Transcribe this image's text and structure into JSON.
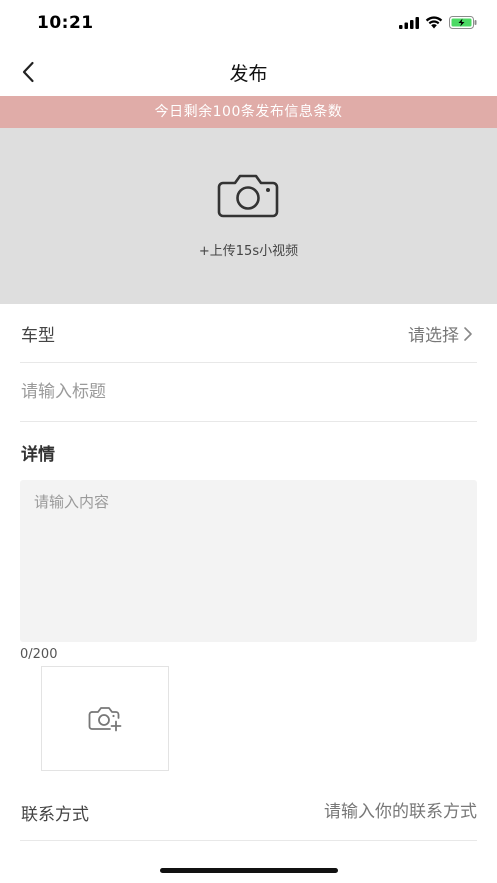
{
  "status_bar": {
    "time": "10:21",
    "icons": [
      "signal-icon",
      "wifi-icon",
      "battery-charging-icon"
    ],
    "battery_color": "#4cd964"
  },
  "nav": {
    "title": "发布",
    "back_icon": "chevron-left-icon"
  },
  "notice": {
    "text": "今日剩余100条发布信息条数",
    "background": "#e0aca8"
  },
  "video_upload": {
    "icon": "camera-icon",
    "label": "+上传15s小视频"
  },
  "form": {
    "car_model": {
      "label": "车型",
      "value": "请选择",
      "icon": "chevron-right-icon"
    },
    "title": {
      "value": "",
      "placeholder": "请输入标题"
    },
    "details_heading": "详情",
    "content": {
      "value": "",
      "placeholder": "请输入内容"
    },
    "char_counter": "0/200",
    "image_upload": {
      "icon": "camera-add-icon"
    },
    "contact": {
      "label": "联系方式",
      "value": "",
      "placeholder": "请输入你的联系方式"
    }
  }
}
